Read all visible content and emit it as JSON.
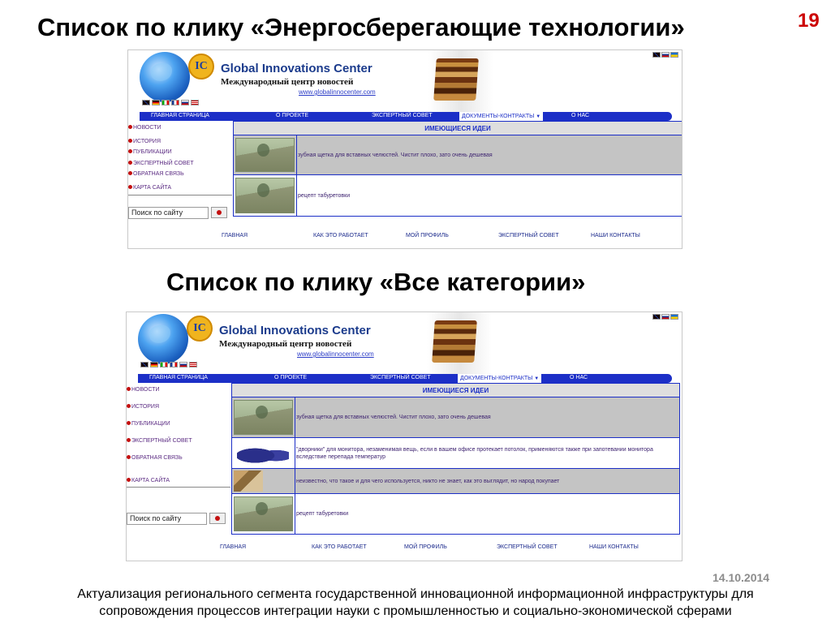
{
  "slide": {
    "title": "Список по клику «Энергосберегающие технологии»",
    "subtitle": "Список по клику «Все категории»",
    "page_number": "19",
    "date": "14.10.2014",
    "footer_line1": "Актуализация регионального сегмента государственной инновационной информационной инфраструктуры для",
    "footer_line2": "сопровождения процессов интеграции науки с промышленностью и социально-экономической сферами"
  },
  "site": {
    "brand_en": "Global Innovations Center",
    "brand_ru": "Международный центр новостей",
    "url": "www.globalinnocenter.com",
    "nav": [
      "ГЛАВНАЯ СТРАНИЦА",
      "О ПРОЕКТЕ",
      "ЭКСПЕРТНЫЙ СОВЕТ",
      "ДОКУМЕНТЫ-КОНТРАКТЫ",
      "О НАС"
    ],
    "sidebar": [
      "НОВОСТИ",
      "ИСТОРИЯ",
      "ПУБЛИКАЦИИ",
      "ЭКСПЕРТНЫЙ СОВЕТ",
      "ОБРАТНАЯ СВЯЗЬ",
      "КАРТА САЙТА"
    ],
    "search_placeholder": "Поиск по сайту",
    "ideas_header": "ИМЕЮЩИЕСЯ ИДЕИ",
    "footer_links": [
      "ГЛАВНАЯ",
      "КАК ЭТО РАБОТАЕТ",
      "МОЙ ПРОФИЛЬ",
      "ЭКСПЕРТНЫЙ СОВЕТ",
      "НАШИ КОНТАКТЫ"
    ]
  },
  "screen1": {
    "ideas": [
      {
        "thumb": "money-icon",
        "text": "зубная щетка для вставных челюстей. Чистит плохо, зато очень дешевая"
      },
      {
        "thumb": "money-icon",
        "text": "рецепт табуретовки"
      }
    ]
  },
  "screen2": {
    "ideas": [
      {
        "thumb": "money-icon",
        "text": "зубная щетка для вставных челюстей. Чистит плохо, зато очень дешевая"
      },
      {
        "thumb": "vacuum-icon",
        "text": "\"дворники\" для монитора, незаменимая вещь, если в вашем офисе протекает потолок, применяются также при запотевании монитора вследствие перепада температур"
      },
      {
        "thumb": "boxes-icon",
        "text": "неизвестно, что такое и для чего используется, никто не знает, как это выглядит, но народ покупает"
      },
      {
        "thumb": "money-icon",
        "text": "рецепт табуретовки"
      }
    ]
  }
}
